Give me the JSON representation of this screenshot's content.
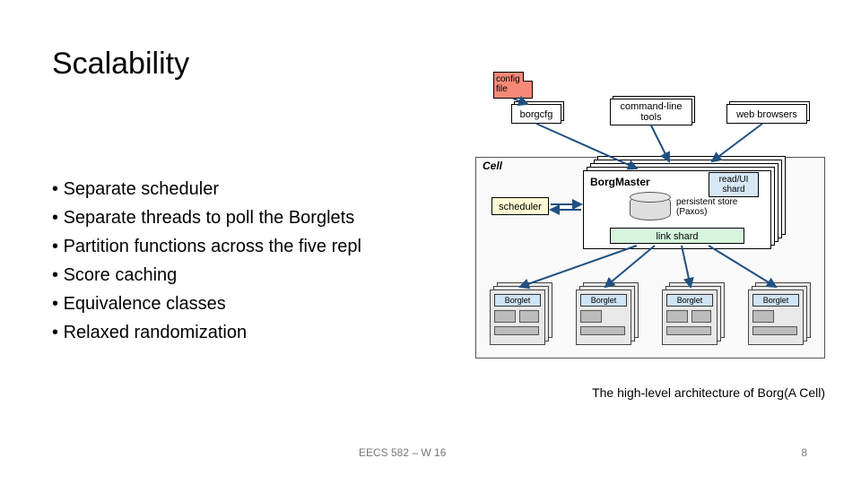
{
  "title": "Scalability",
  "bullets": [
    "Separate scheduler",
    "Separate threads to poll the Borglets",
    "Partition functions across the five repl",
    "Score caching",
    "Equivalence classes",
    "Relaxed randomization"
  ],
  "caption": "The high-level architecture of Borg(A Cell)",
  "footer": {
    "course": "EECS 582 – W 16",
    "page": "8"
  },
  "diagram": {
    "config_file": "config\nfile",
    "borgcfg": "borgcfg",
    "cmdline": "command-line\ntools",
    "browsers": "web browsers",
    "cell_label": "Cell",
    "borgmaster": "BorgMaster",
    "read_ui": "read/UI\nshard",
    "persistent": "persistent store\n(Paxos)",
    "link_shard": "link shard",
    "scheduler": "scheduler",
    "borglet": "Borglet"
  }
}
